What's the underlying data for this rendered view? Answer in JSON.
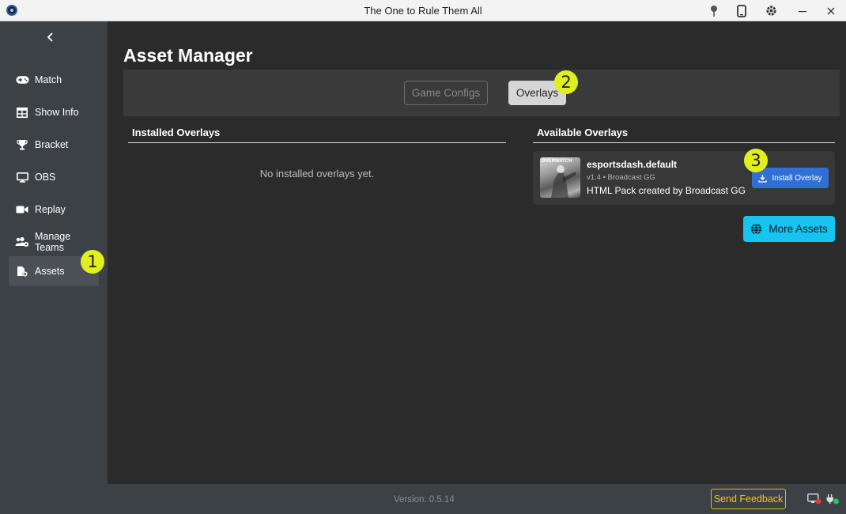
{
  "window": {
    "title": "The One to Rule Them All"
  },
  "sidebar": {
    "items": [
      {
        "label": "Match",
        "icon": "gamepad-icon"
      },
      {
        "label": "Show Info",
        "icon": "table-icon"
      },
      {
        "label": "Bracket",
        "icon": "trophy-icon"
      },
      {
        "label": "OBS",
        "icon": "monitor-icon"
      },
      {
        "label": "Replay",
        "icon": "video-camera-icon"
      },
      {
        "label": "Manage Teams",
        "icon": "users-gear-icon"
      },
      {
        "label": "Assets",
        "icon": "file-gear-icon",
        "active": true
      }
    ]
  },
  "main": {
    "title": "Asset Manager",
    "tabs": [
      {
        "label": "Game Configs",
        "selected": false
      },
      {
        "label": "Overlays",
        "selected": true
      }
    ],
    "installed": {
      "heading": "Installed Overlays",
      "empty_text": "No installed overlays yet."
    },
    "available": {
      "heading": "Available Overlays",
      "items": [
        {
          "name": "esportsdash.default",
          "meta": "v1.4 • Broadcast GG",
          "description": "HTML Pack created by Broadcast GG",
          "thumb_label": "OVERWATCH",
          "install_label": "Install Overlay"
        }
      ],
      "more_label": "More Assets"
    }
  },
  "annotations": [
    "1",
    "2",
    "3"
  ],
  "footer": {
    "version": "Version: 0.5.14",
    "feedback_label": "Send Feedback"
  },
  "colors": {
    "accent_blue": "#2f6fd6",
    "accent_cyan": "#17c3ef",
    "badge_yellow": "#e1ef1e",
    "feedback_gold": "#f0c419"
  }
}
